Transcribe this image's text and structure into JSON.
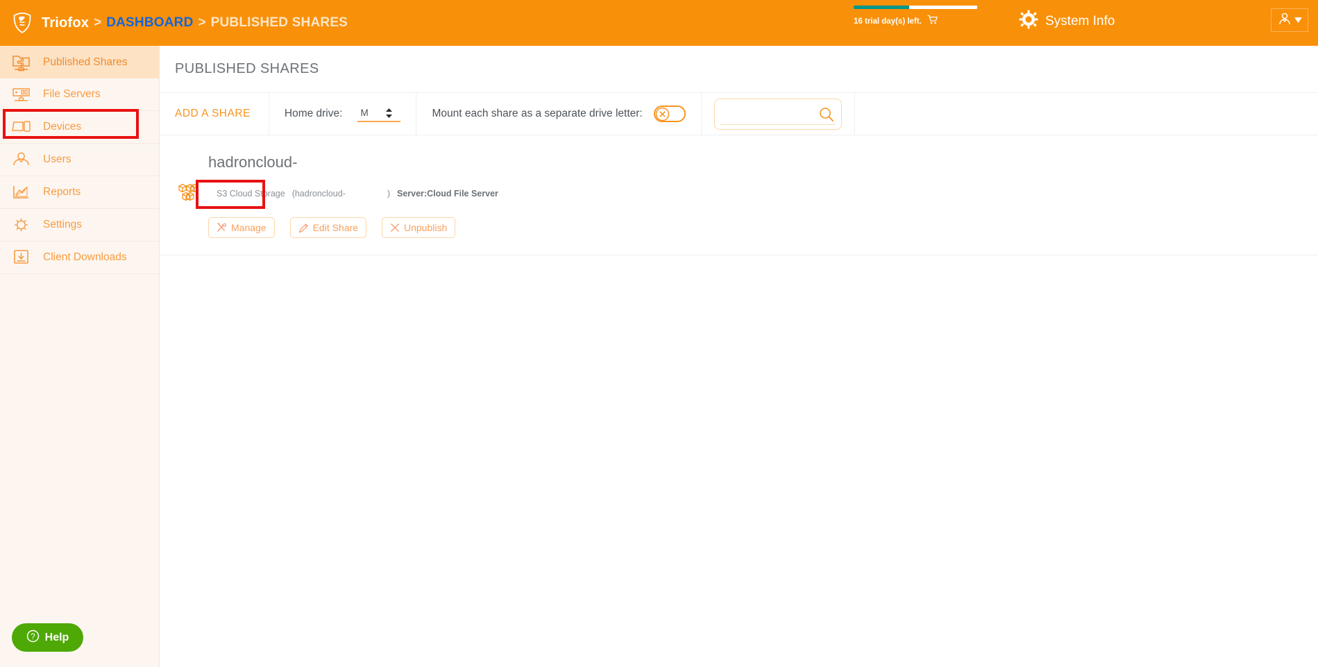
{
  "header": {
    "brand": "Triofox",
    "separator": ">",
    "breadcrumb_dashboard": "DASHBOARD",
    "breadcrumb_current": "PUBLISHED SHARES",
    "trial_text": "16 trial day(s) left.",
    "trial_progress_percent": 45,
    "trial_bar_color": "#00968b",
    "cart_icon": "shopping-cart-icon",
    "system_info_label": "System Info",
    "gear_icon": "gear-icon",
    "avatar_icon": "user-avatar-icon",
    "caret_icon": "chevron-down-icon",
    "background_color": "#f99009"
  },
  "sidebar": {
    "items": [
      {
        "label": "Published Shares",
        "icon": "published-shares-icon",
        "active": true
      },
      {
        "label": "File Servers",
        "icon": "file-servers-icon",
        "active": false
      },
      {
        "label": "Devices",
        "icon": "devices-icon",
        "active": false
      },
      {
        "label": "Users",
        "icon": "users-icon",
        "active": false
      },
      {
        "label": "Reports",
        "icon": "reports-icon",
        "active": false
      },
      {
        "label": "Settings",
        "icon": "settings-gear-icon",
        "active": false
      },
      {
        "label": "Client Downloads",
        "icon": "client-downloads-icon",
        "active": false
      }
    ],
    "help_button": {
      "label": "Help",
      "icon": "question-mark-icon",
      "color": "#4ea806"
    },
    "background_color": "#fdf6f0",
    "active_background_color": "#fde2c4",
    "text_color": "#f79c42"
  },
  "main": {
    "page_title": "PUBLISHED SHARES",
    "toolbar": {
      "add_share_label": "ADD A SHARE",
      "home_drive_label": "Home drive:",
      "home_drive_value": "M",
      "home_drive_options": [
        "M"
      ],
      "mount_label": "Mount each share as a separate drive letter:",
      "mount_toggle_state": "off",
      "search_value": "",
      "search_placeholder": "",
      "search_icon": "search-icon"
    },
    "shares": [
      {
        "title": "hadroncloud-",
        "storage_icon": "s3-cloud-storage-icon",
        "storage_type": "S3 Cloud Storage",
        "storage_detail_open": "(hadroncloud-",
        "storage_detail_close": ")",
        "server_label": "Server:Cloud File Server",
        "buttons": [
          {
            "label": "Manage",
            "icon": "tools-icon",
            "highlighted": true
          },
          {
            "label": "Edit Share",
            "icon": "pencil-icon",
            "highlighted": false
          },
          {
            "label": "Unpublish",
            "icon": "close-x-icon",
            "highlighted": false
          }
        ]
      }
    ]
  },
  "annotations": {
    "highlight_color": "#e81212",
    "targets": [
      "sidebar-item-published-shares",
      "manage-button"
    ]
  }
}
